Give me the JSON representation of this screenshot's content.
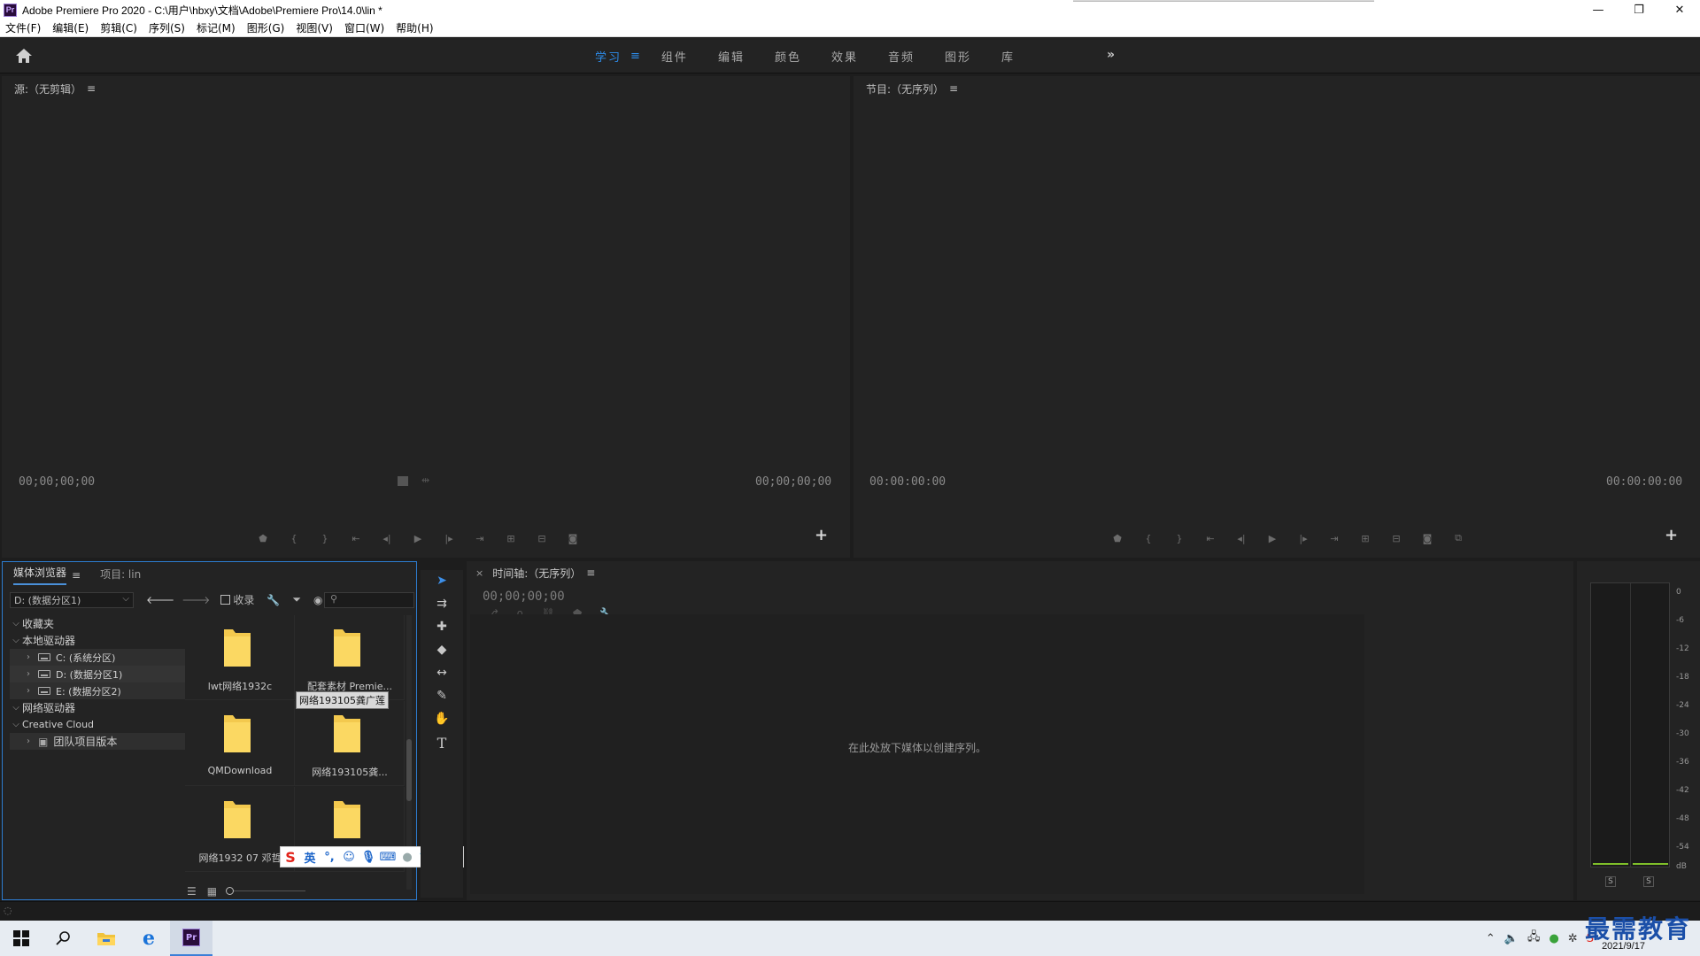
{
  "window": {
    "title": "Adobe Premiere Pro 2020 - C:\\用户\\hbxy\\文档\\Adobe\\Premiere Pro\\14.0\\lin *",
    "app_icon": "Pr",
    "minimize": "—",
    "restore": "❐",
    "close": "✕"
  },
  "menubar": [
    "文件(F)",
    "编辑(E)",
    "剪辑(C)",
    "序列(S)",
    "标记(M)",
    "图形(G)",
    "视图(V)",
    "窗口(W)",
    "帮助(H)"
  ],
  "workspace": {
    "tabs": [
      "学习",
      "组件",
      "编辑",
      "颜色",
      "效果",
      "音频",
      "图形",
      "库"
    ],
    "active_tab": "学习",
    "menu_glyph": "≡",
    "more_glyph": "»"
  },
  "source_monitor": {
    "title": "源:（无剪辑）",
    "menu_glyph": "≡",
    "timecode_left": "00;00;00;00",
    "timecode_right": "00;00;00;00",
    "add_button": "+"
  },
  "program_monitor": {
    "title": "节目:（无序列）",
    "menu_glyph": "≡",
    "timecode_left": "00:00:00:00",
    "timecode_right": "00:00:00:00",
    "add_button": "+"
  },
  "media_browser": {
    "tab_active": "媒体浏览器",
    "tab_other": "项目: lin",
    "menu_glyph": "≡",
    "drive_selected": "D: (数据分区1)",
    "ingest_label": "收录",
    "search_placeholder": "",
    "tree": [
      {
        "label": "收藏夹",
        "chevron": "⌵",
        "indent": 0
      },
      {
        "label": "本地驱动器",
        "chevron": "⌵",
        "indent": 0
      },
      {
        "label": "C: (系统分区)",
        "chevron": "›",
        "indent": 1
      },
      {
        "label": "D: (数据分区1)",
        "chevron": "›",
        "indent": 1
      },
      {
        "label": "E: (数据分区2)",
        "chevron": "›",
        "indent": 1
      },
      {
        "label": "网络驱动器",
        "chevron": "⌵",
        "indent": 0
      },
      {
        "label": "Creative Cloud",
        "chevron": "⌵",
        "indent": 0
      },
      {
        "label": "团队项目版本",
        "chevron": "›",
        "indent": 1
      }
    ],
    "folders": [
      {
        "label": "lwt网络1932c"
      },
      {
        "label": "配套素材 Premie..."
      },
      {
        "label": "QMDownload"
      },
      {
        "label": "网络193105龚..."
      },
      {
        "label": "网络1932 07 邓哲"
      },
      {
        "label": ""
      }
    ],
    "tooltip": "网络193105龚广莲"
  },
  "timeline": {
    "title": "时间轴:（无序列）",
    "close": "×",
    "menu_glyph": "≡",
    "timecode": "00;00;00;00",
    "drop_hint": "在此处放下媒体以创建序列。"
  },
  "audio_meter": {
    "scale": [
      "0",
      "-6",
      "-12",
      "-18",
      "-24",
      "-30",
      "-36",
      "-42",
      "-48",
      "-54",
      "dB"
    ],
    "solo_left": "S",
    "solo_right": "S"
  },
  "ime": {
    "mode": "英",
    "logo": "S"
  },
  "taskbar": {
    "date": "2021/9/17",
    "time": "",
    "watermark": "最需教育",
    "icons": [
      "windows-start",
      "search",
      "file-explorer",
      "edge",
      "premiere"
    ]
  },
  "colors": {
    "accent": "#2d8ceb",
    "panel": "#232323",
    "folder": "#f3c94e"
  }
}
